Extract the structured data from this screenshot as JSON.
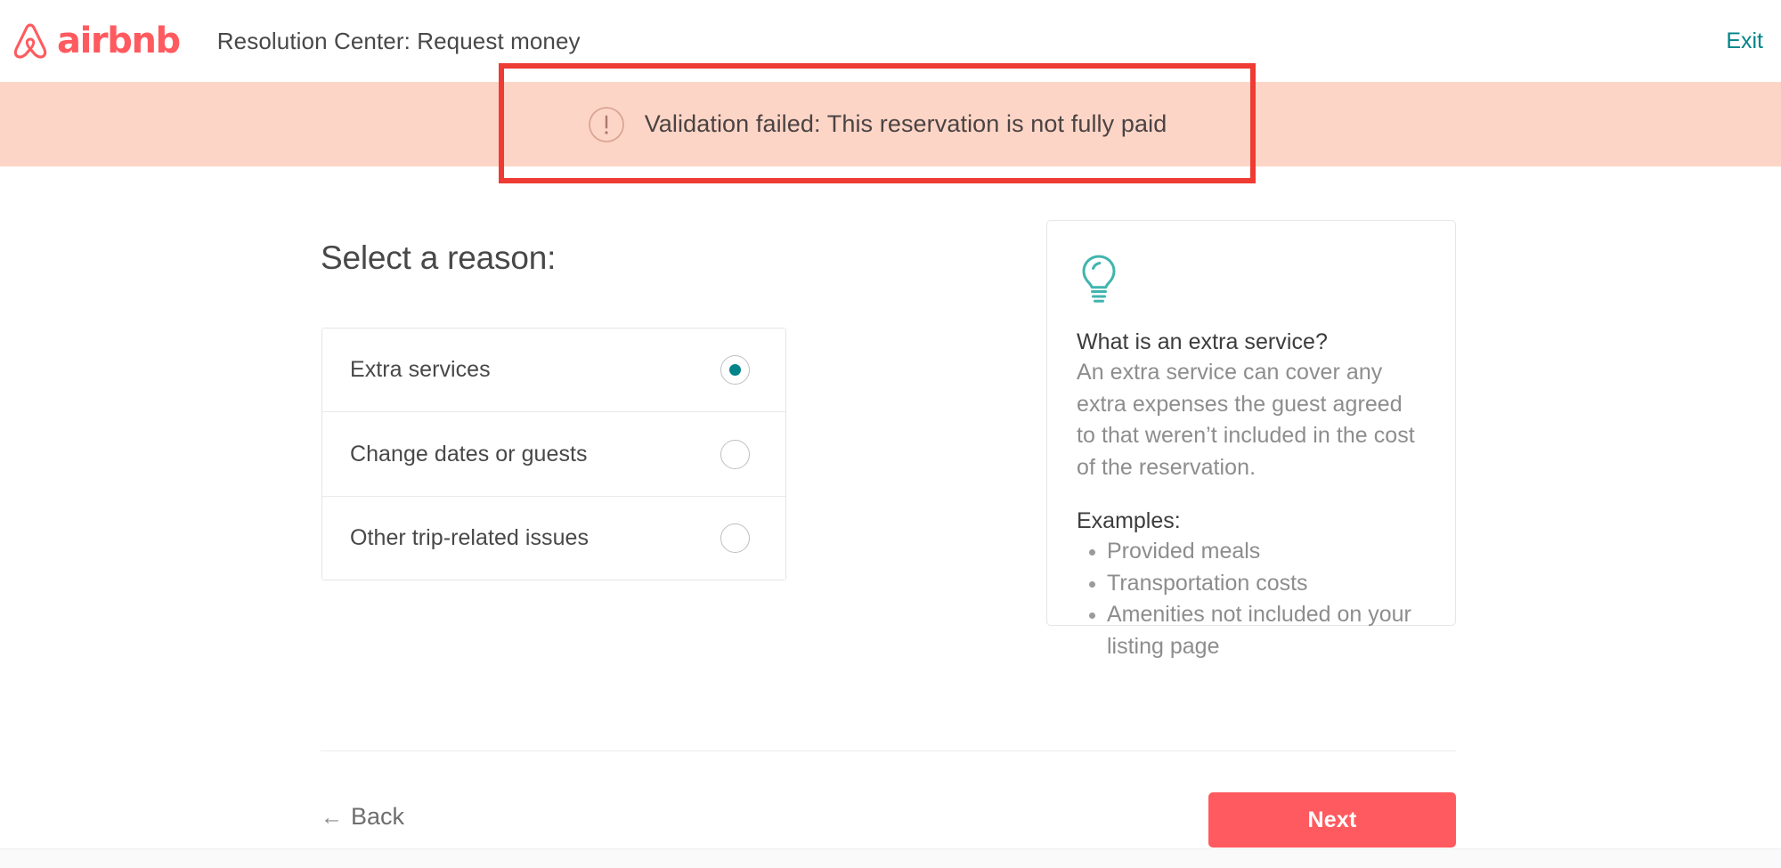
{
  "header": {
    "brand_name": "airbnb",
    "brand_color": "#FF5A5F",
    "title": "Resolution Center: Request money",
    "exit_label": "Exit",
    "exit_color": "#00848A"
  },
  "alert": {
    "icon": "exclamation-circle-icon",
    "message": "Validation failed: This reservation is not fully paid",
    "background": "#FDD5C6",
    "text_color": "#4A4343",
    "highlight_color": "#EE3B33"
  },
  "main": {
    "heading": "Select a reason:",
    "reasons": [
      {
        "label": "Extra services",
        "selected": true
      },
      {
        "label": "Change dates or guests",
        "selected": false
      },
      {
        "label": "Other trip-related issues",
        "selected": false
      }
    ],
    "selected_color": "#00848A"
  },
  "info_card": {
    "icon": "lightbulb-icon",
    "icon_color": "#3FB5AE",
    "title": "What is an extra service?",
    "body": "An extra service can cover any extra expenses the guest agreed to that weren’t included in the cost of the reservation.",
    "examples_title": "Examples:",
    "examples": [
      "Provided meals",
      "Transportation costs",
      "Amenities not included on your listing page"
    ]
  },
  "footer": {
    "back_label": "Back",
    "back_arrow": "←",
    "next_label": "Next",
    "next_color": "#FF5A5F"
  }
}
